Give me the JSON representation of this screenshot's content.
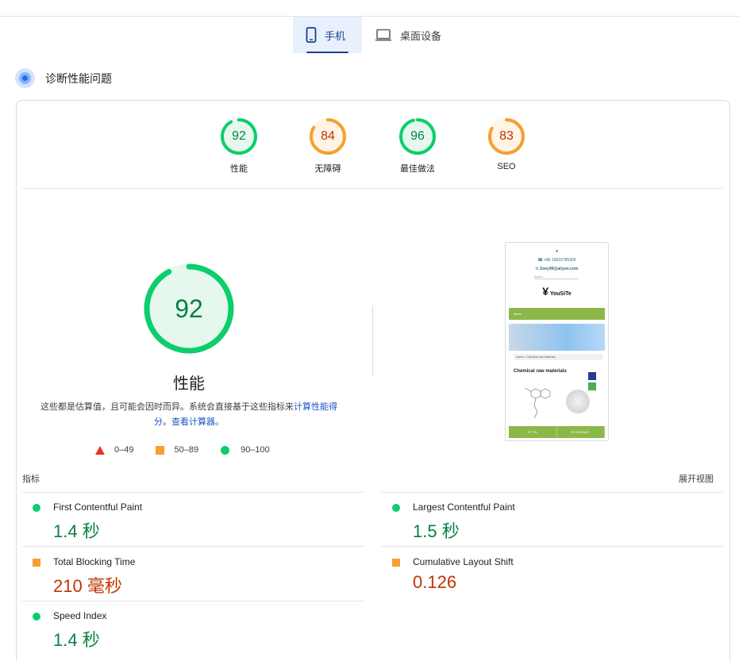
{
  "tabs": [
    {
      "label": "手机",
      "icon": "phone-icon",
      "active": true
    },
    {
      "label": "桌面设备",
      "icon": "laptop-icon",
      "active": false
    }
  ],
  "diagnose": {
    "label": "诊断性能问题",
    "icon": "lighthouse-icon"
  },
  "categories": [
    {
      "score": "92",
      "label": "性能",
      "value": 92,
      "color": "#0cce6b",
      "text_color": "#0a8043"
    },
    {
      "score": "84",
      "label": "无障碍",
      "value": 84,
      "color": "#f5a030",
      "text_color": "#c33300"
    },
    {
      "score": "96",
      "label": "最佳做法",
      "value": 96,
      "color": "#0cce6b",
      "text_color": "#0a8043"
    },
    {
      "score": "83",
      "label": "SEO",
      "value": 83,
      "color": "#f5a030",
      "text_color": "#c33300"
    }
  ],
  "performance": {
    "score": "92",
    "value": 92,
    "title": "性能",
    "desc_prefix": "这些都是估算值，且可能会因时而异。系统会直接基于这些指标来",
    "desc_link1": "计算性能得分",
    "desc_mid": "。",
    "desc_link2": "查看计算器。"
  },
  "legend": [
    {
      "range": "0–49",
      "shape": "triangle",
      "color": "#eb3223"
    },
    {
      "range": "50–89",
      "shape": "square",
      "color": "#f5a030"
    },
    {
      "range": "90–100",
      "shape": "circle",
      "color": "#0cce6b"
    }
  ],
  "thumbnail": {
    "phone": "+86 19032785305",
    "email": "Zoey99@aliyun.com",
    "search": "Search",
    "brand": "YouSiTe",
    "menu": "Menu",
    "breadcrumb": "Home  >  Chemical raw materials",
    "heading": "Chemical raw materials",
    "tel": "TEL",
    "contact": "CONTACT"
  },
  "metrics_header": {
    "title": "指标",
    "expand": "展开视图"
  },
  "metrics": [
    {
      "name": "First Contentful Paint",
      "value": "1.4 秒",
      "status": "good"
    },
    {
      "name": "Largest Contentful Paint",
      "value": "1.5 秒",
      "status": "good"
    },
    {
      "name": "Total Blocking Time",
      "value": "210 毫秒",
      "status": "average"
    },
    {
      "name": "Cumulative Layout Shift",
      "value": "0.126",
      "status": "average"
    },
    {
      "name": "Speed Index",
      "value": "1.4 秒",
      "status": "good"
    }
  ]
}
